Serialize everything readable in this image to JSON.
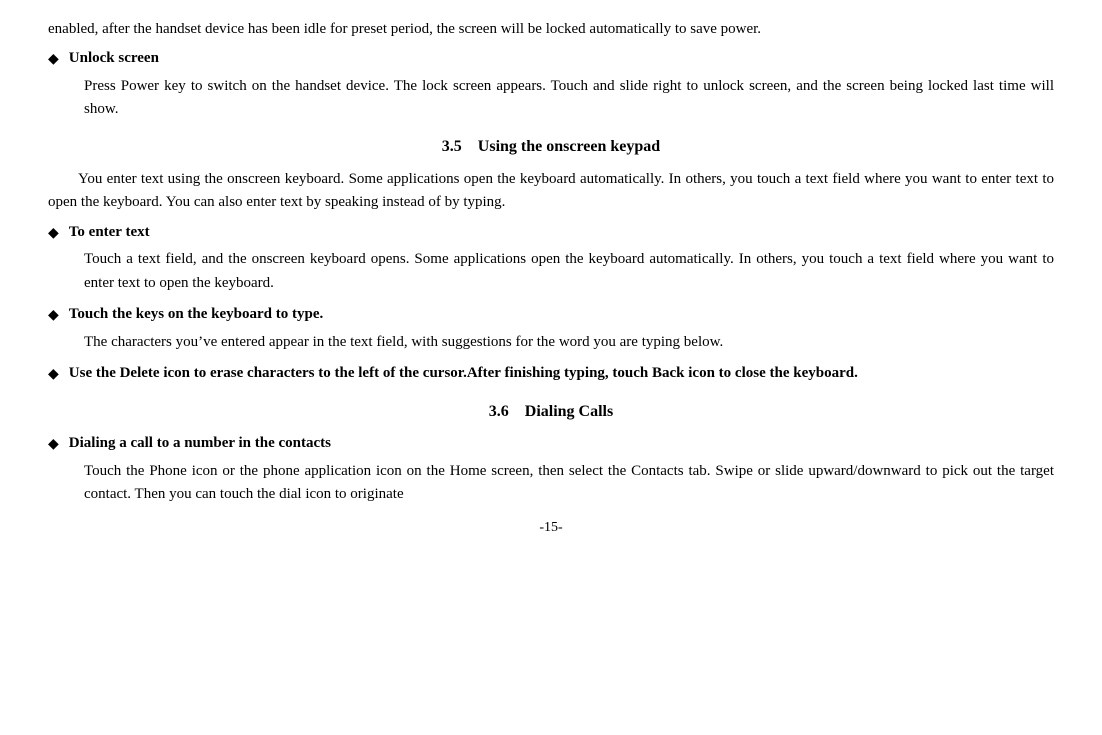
{
  "intro": {
    "text": "enabled, after the handset device has been idle for preset period, the screen will be locked automatically to save power."
  },
  "sections": [
    {
      "type": "bullet",
      "title": "Unlock screen",
      "body": "Press Power key to switch on the handset device. The lock screen appears. Touch and slide right to unlock screen, and the screen being locked last time will show."
    },
    {
      "type": "heading",
      "number": "3.5",
      "label": "Using the onscreen keypad"
    },
    {
      "type": "para",
      "text": "You enter text using the onscreen keyboard. Some applications open the keyboard automatically. In others, you touch a text field where you want to enter text to open the keyboard. You can also enter text by speaking instead of by typing."
    },
    {
      "type": "bullet",
      "title": "To enter text",
      "body": "Touch a text field, and the onscreen keyboard opens. Some applications open the keyboard automatically. In others, you touch a text field where you want to enter text to open the keyboard."
    },
    {
      "type": "bullet",
      "title": "Touch the keys on the keyboard to type.",
      "body": "The characters you’ve entered appear in the text field, with suggestions for the word you are typing below."
    },
    {
      "type": "bullet",
      "title": "Use the Delete icon to erase characters to the left of the cursor.After finishing typing, touch Back icon to close the keyboard.",
      "body": ""
    },
    {
      "type": "heading",
      "number": "3.6",
      "label": "Dialing Calls"
    },
    {
      "type": "bullet",
      "title": "Dialing a call to a number in the contacts",
      "body": "Touch the Phone icon or the phone application icon on the Home screen, then select the Contacts tab. Swipe or slide upward/downward to pick out the target contact. Then you can touch the dial icon to originate"
    }
  ],
  "page_number": "-15-"
}
